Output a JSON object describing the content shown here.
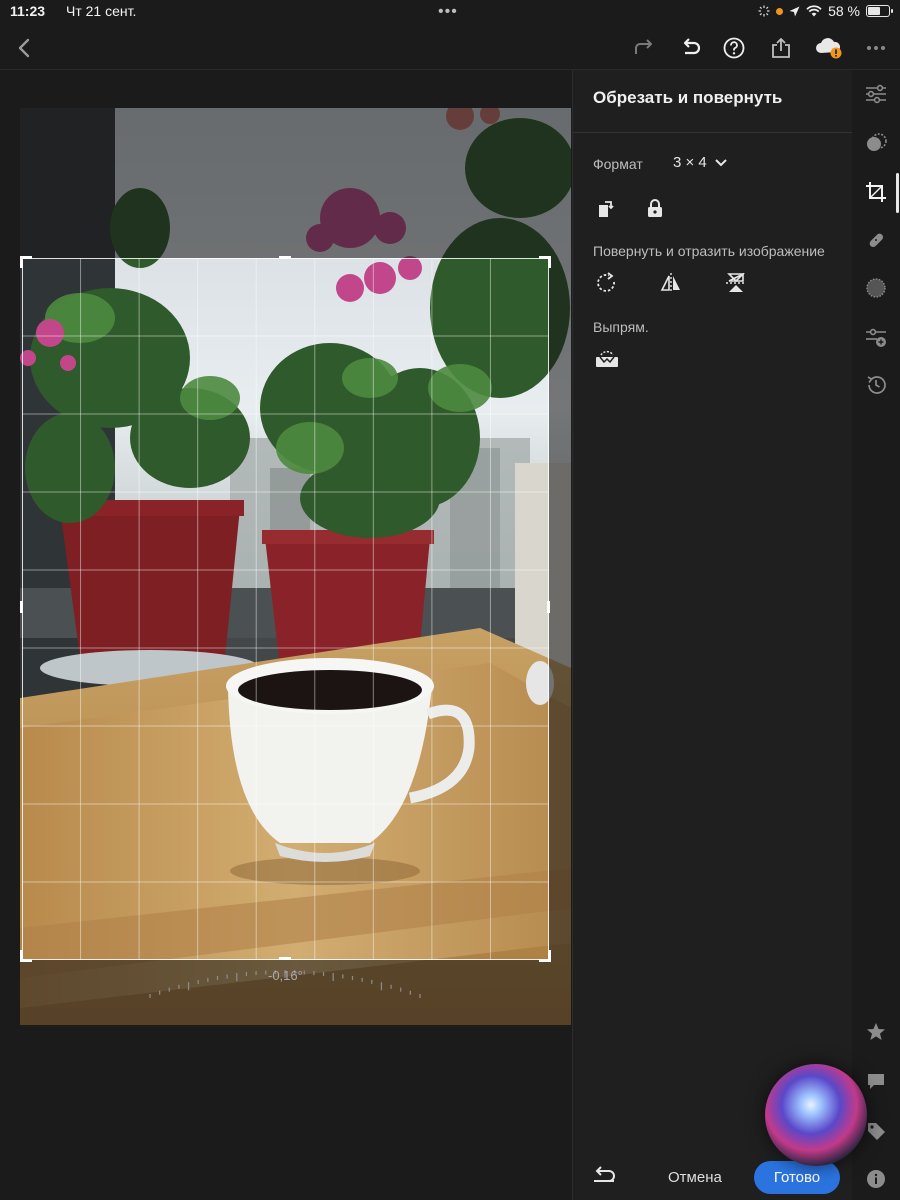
{
  "status_bar": {
    "time": "11:23",
    "date": "Чт 21 сент.",
    "battery_text": "58 %",
    "battery_level": 0.58
  },
  "toolbar": {
    "back_icon": "chevron-left-icon",
    "redo_icon": "redo-icon",
    "undo_icon": "undo-icon",
    "help_icon": "help-icon",
    "share_icon": "share-icon",
    "cloud_icon": "cloud-warning-icon",
    "more_icon": "more-icon"
  },
  "canvas": {
    "angle": "-0,16°"
  },
  "panel": {
    "title": "Обрезать и повернуть",
    "format_label": "Формат",
    "format_value": "3 × 4",
    "rotate_label": "Повернуть и отразить изображение",
    "straighten_label": "Выпрям."
  },
  "footer": {
    "cancel": "Отмена",
    "done": "Готово"
  },
  "colors": {
    "accent": "#2b74e0",
    "background": "#1b1b1b",
    "panel": "#1f1f1f"
  }
}
